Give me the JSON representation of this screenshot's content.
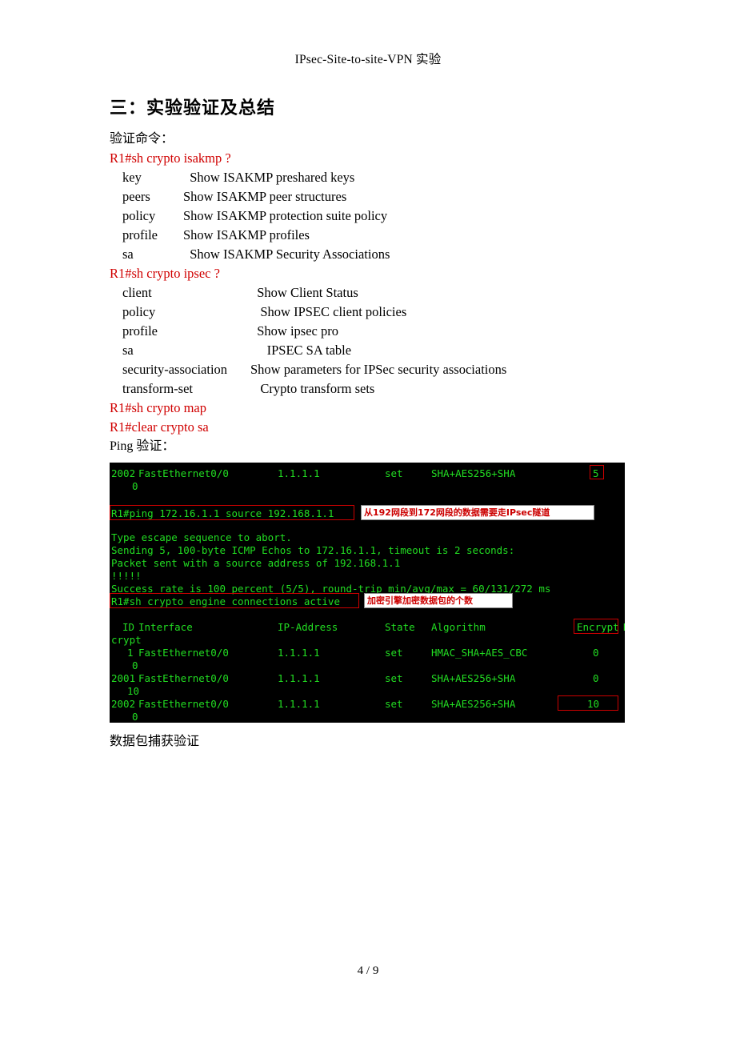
{
  "document": {
    "header_title": "IPsec-Site-to-site-VPN 实验",
    "section_title": "三：实验验证及总结",
    "intro_label": "验证命令：",
    "ping_label": "Ping 验证：",
    "caption": "数据包捕获验证",
    "footer": "4 / 9"
  },
  "commands": {
    "isakmp": "R1#sh crypto isakmp ?",
    "ipsec": "R1#sh crypto ipsec ?",
    "map": "R1#sh crypto map",
    "clear_sa": "R1#clear crypto sa"
  },
  "isakmp_options": [
    {
      "key": "key",
      "desc": "  Show ISAKMP preshared keys"
    },
    {
      "key": "peers",
      "desc": "Show ISAKMP peer structures"
    },
    {
      "key": "policy",
      "desc": "Show ISAKMP protection suite policy"
    },
    {
      "key": "profile",
      "desc": "Show ISAKMP profiles"
    },
    {
      "key": "sa",
      "desc": "  Show ISAKMP Security Associations"
    }
  ],
  "ipsec_options": [
    {
      "key": "client",
      "desc": "  Show Client Status"
    },
    {
      "key": "policy",
      "desc": "   Show IPSEC client policies"
    },
    {
      "key": "profile",
      "desc": "  Show ipsec pro"
    },
    {
      "key": "sa",
      "desc": "     IPSEC SA table"
    },
    {
      "key": "security-association",
      "desc": "Show parameters for IPSec security associations"
    },
    {
      "key": "transform-set",
      "desc": "   Crypto transform sets"
    }
  ],
  "terminal": {
    "top_row": {
      "id": "2002",
      "interface": "FastEthernet0/0",
      "ip": "1.1.1.1",
      "state": "set",
      "algorithm": "SHA+AES256+SHA",
      "encrypt": "5",
      "decrypt": "0"
    },
    "ping_command": "R1#ping 172.16.1.1 source 192.168.1.1",
    "ping_output": [
      "Type escape sequence to abort.",
      "Sending 5, 100-byte ICMP Echos to 172.16.1.1, timeout is 2 seconds:",
      "Packet sent with a source address of 192.168.1.1",
      "!!!!!",
      "Success rate is 100 percent (5/5), round-trip min/avg/max = 60/131/272 ms"
    ],
    "engine_command": "R1#sh crypto engine connections active",
    "table_header": {
      "id": "ID",
      "interface": "Interface",
      "ip": "IP-Address",
      "state": "State",
      "algorithm": "Algorithm",
      "encrypt": "Encrypt",
      "decrypt_part1": "De",
      "decrypt_part2": "crypt"
    },
    "table_rows": [
      {
        "id": "1",
        "interface": "FastEthernet0/0",
        "ip": "1.1.1.1",
        "state": "set",
        "algorithm": "HMAC_SHA+AES_CBC",
        "encrypt": "0",
        "decrypt": "0"
      },
      {
        "id": "2001",
        "interface": "FastEthernet0/0",
        "ip": "1.1.1.1",
        "state": "set",
        "algorithm": "SHA+AES256+SHA",
        "encrypt": "0",
        "decrypt": "10"
      },
      {
        "id": "2002",
        "interface": "FastEthernet0/0",
        "ip": "1.1.1.1",
        "state": "set",
        "algorithm": "SHA+AES256+SHA",
        "encrypt": "10",
        "decrypt": "0"
      }
    ],
    "annotations": {
      "ping_note": "从192网段到172网段的数据需要走IPsec隧道",
      "engine_note": "加密引擎加密数据包的个数"
    }
  },
  "colors": {
    "command_red": "#d00000",
    "terminal_green": "#22dd22",
    "terminal_bg": "#000000",
    "highlight_box": "#cc0000"
  }
}
